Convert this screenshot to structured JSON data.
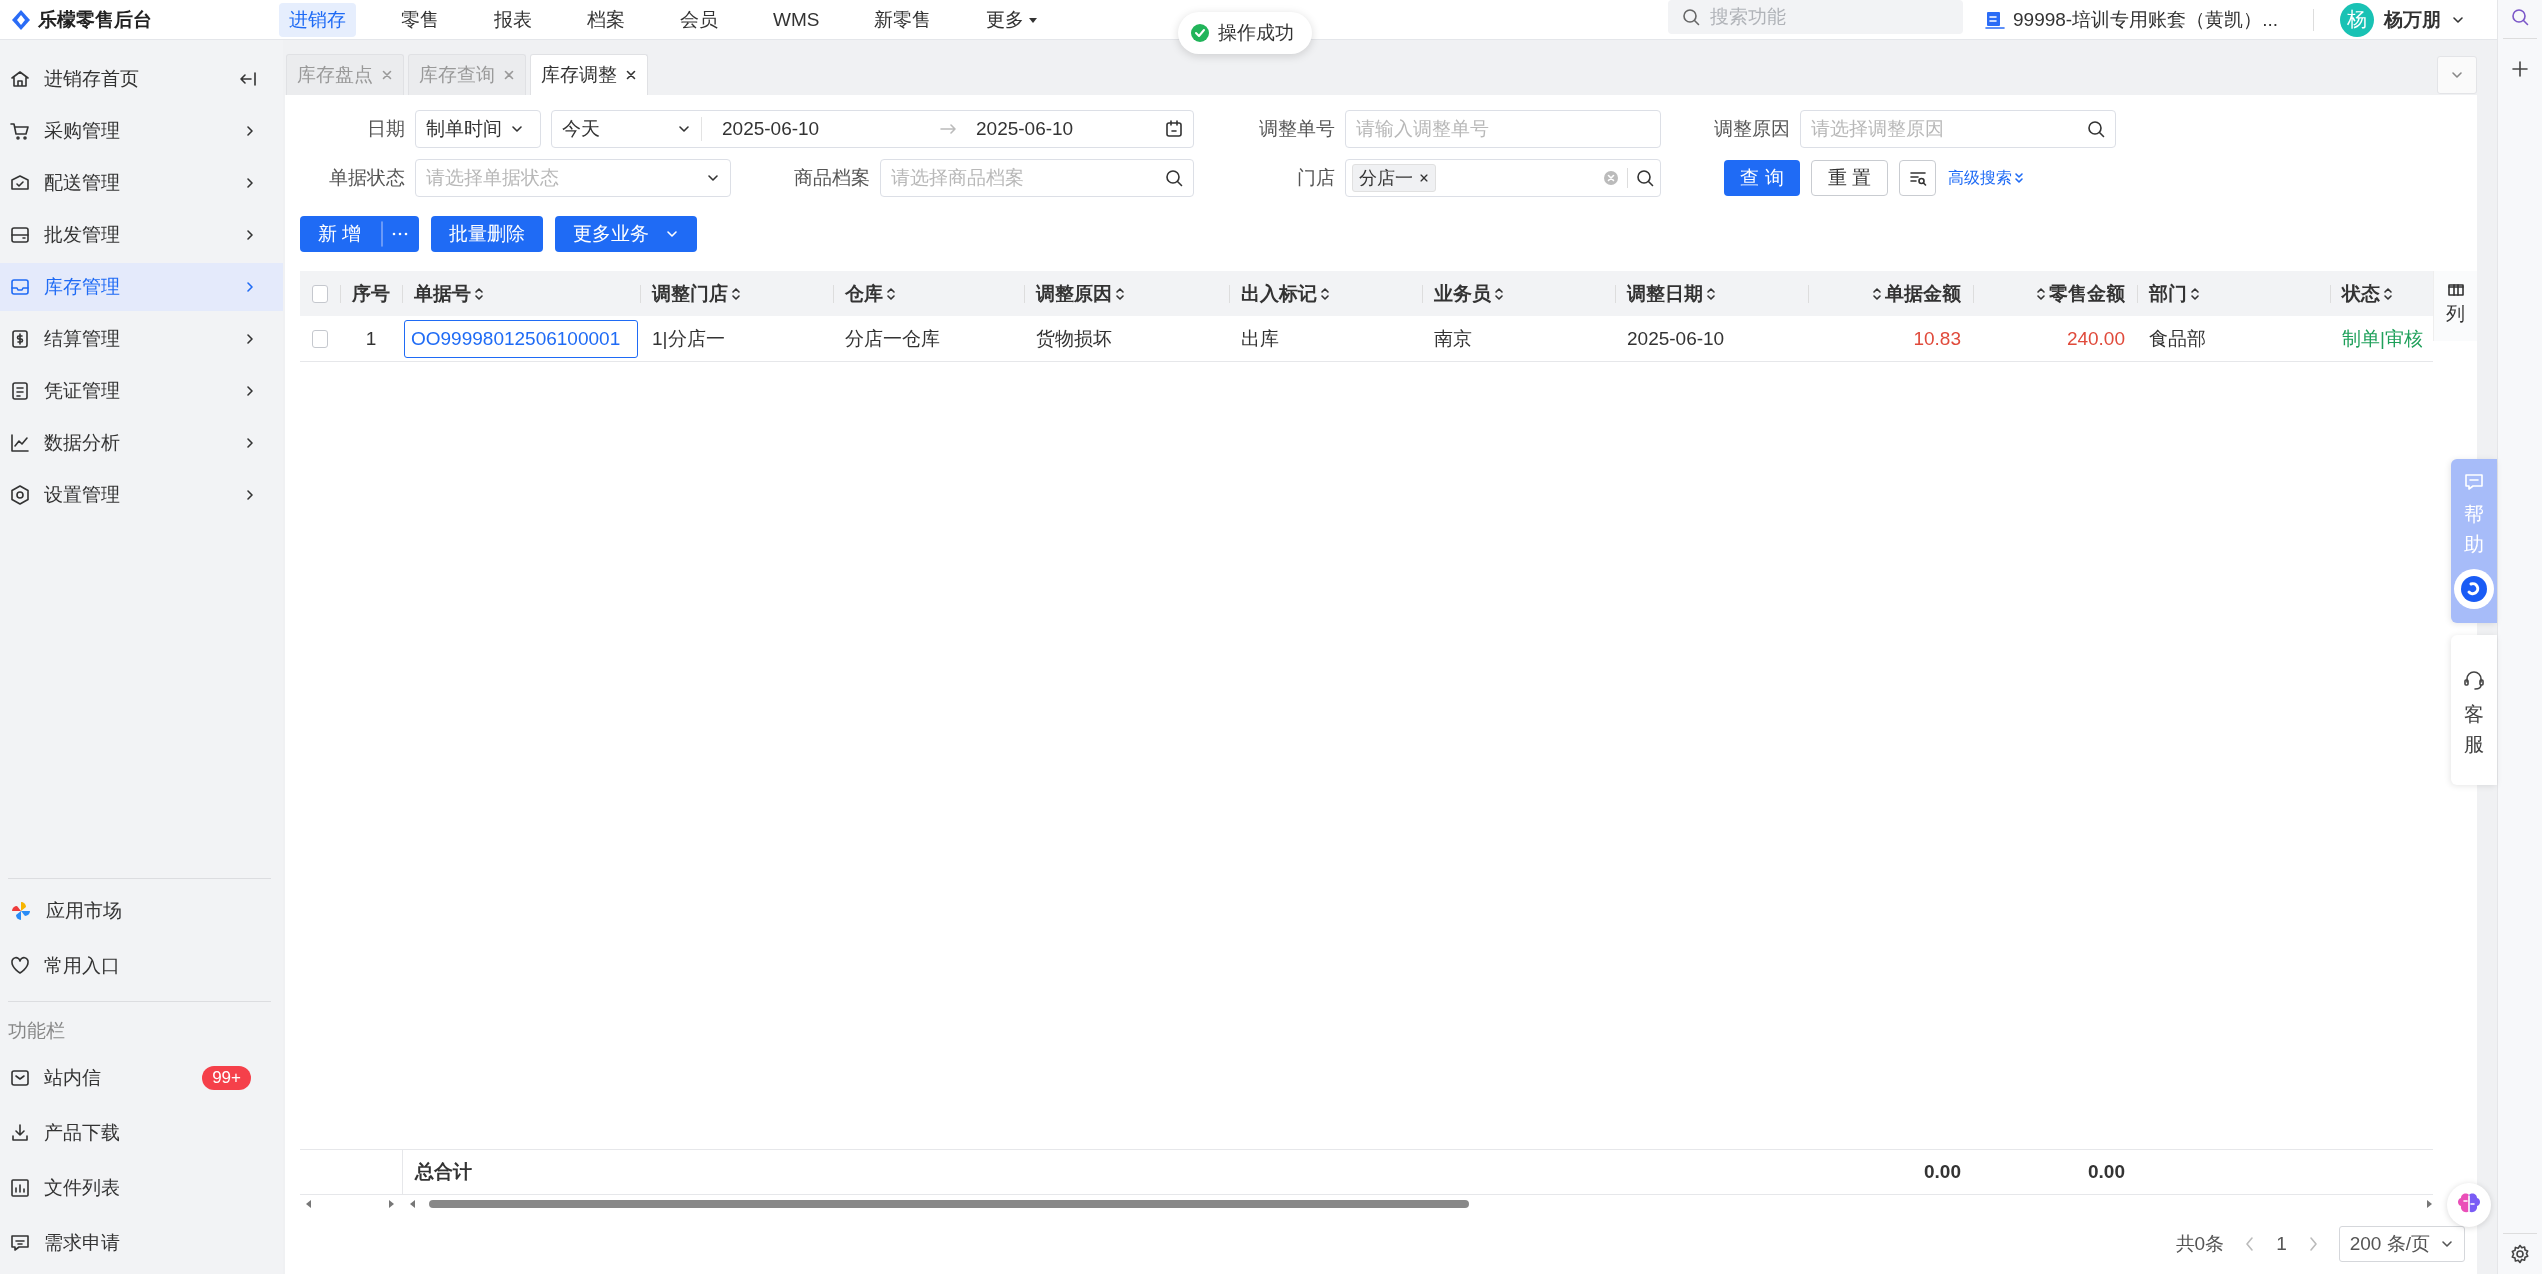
{
  "app": {
    "title": "乐檬零售后台"
  },
  "top_nav": [
    {
      "label": "进销存",
      "selected": true,
      "kind": "link"
    },
    {
      "label": "零售",
      "selected": false,
      "kind": "link"
    },
    {
      "label": "报表",
      "selected": false,
      "kind": "link"
    },
    {
      "label": "档案",
      "selected": false,
      "kind": "link"
    },
    {
      "label": "会员",
      "selected": false,
      "kind": "link"
    },
    {
      "label": "WMS",
      "selected": false,
      "kind": "link"
    },
    {
      "label": "新零售",
      "selected": false,
      "kind": "link"
    },
    {
      "label": "更多",
      "selected": false,
      "kind": "menu"
    }
  ],
  "toast": {
    "text": "操作成功"
  },
  "search": {
    "placeholder": "搜索功能"
  },
  "account": {
    "text": "99998-培训专用账套（黄凯）..."
  },
  "user": {
    "avatar": "杨",
    "name": "杨万朋"
  },
  "sidebar": {
    "items": [
      {
        "label": "进销存首页",
        "selected": false,
        "kind": "home"
      },
      {
        "label": "采购管理",
        "selected": false,
        "kind": "group"
      },
      {
        "label": "配送管理",
        "selected": false,
        "kind": "group"
      },
      {
        "label": "批发管理",
        "selected": false,
        "kind": "group"
      },
      {
        "label": "库存管理",
        "selected": true,
        "kind": "group"
      },
      {
        "label": "结算管理",
        "selected": false,
        "kind": "group"
      },
      {
        "label": "凭证管理",
        "selected": false,
        "kind": "group"
      },
      {
        "label": "数据分析",
        "selected": false,
        "kind": "group"
      },
      {
        "label": "设置管理",
        "selected": false,
        "kind": "group"
      }
    ],
    "shortcuts": [
      {
        "label": "应用市场"
      },
      {
        "label": "常用入口"
      }
    ],
    "tools_title": "功能栏",
    "tools": [
      {
        "label": "站内信",
        "badge": "99+"
      },
      {
        "label": "产品下载"
      },
      {
        "label": "文件列表"
      },
      {
        "label": "需求申请"
      }
    ]
  },
  "tabs": [
    {
      "label": "库存盘点",
      "selected": false
    },
    {
      "label": "库存查询",
      "selected": false
    },
    {
      "label": "库存调整",
      "selected": true
    }
  ],
  "filters": {
    "date": {
      "label": "日期",
      "type_value": "制单时间",
      "preset": "今天",
      "start": "2025-06-10",
      "end": "2025-06-10"
    },
    "adjust_no": {
      "label": "调整单号",
      "placeholder": "请输入调整单号"
    },
    "reason": {
      "label": "调整原因",
      "placeholder": "请选择调整原因"
    },
    "status": {
      "label": "单据状态",
      "placeholder": "请选择单据状态"
    },
    "product": {
      "label": "商品档案",
      "placeholder": "请选择商品档案"
    },
    "store": {
      "label": "门店",
      "tags": [
        "分店一"
      ]
    },
    "query_button": "查 询",
    "reset_button": "重 置",
    "advanced_link": "高级搜索"
  },
  "toolbar": {
    "new_button": "新 增",
    "batch_delete_button": "批量删除",
    "more_button": "更多业务"
  },
  "table": {
    "select_all": {
      "checked": false
    },
    "columns": [
      {
        "label": "序号",
        "kind": "index",
        "sortable": false
      },
      {
        "label": "单据号",
        "kind": "link",
        "sortable": true
      },
      {
        "label": "调整门店",
        "kind": "text",
        "sortable": true
      },
      {
        "label": "仓库",
        "kind": "text",
        "sortable": true
      },
      {
        "label": "调整原因",
        "kind": "text",
        "sortable": true
      },
      {
        "label": "出入标记",
        "kind": "text",
        "sortable": true
      },
      {
        "label": "业务员",
        "kind": "text",
        "sortable": true
      },
      {
        "label": "调整日期",
        "kind": "text",
        "sortable": true
      },
      {
        "label": "单据金额",
        "kind": "amount",
        "sortable": true
      },
      {
        "label": "零售金额",
        "kind": "amount",
        "sortable": true
      },
      {
        "label": "部门",
        "kind": "text",
        "sortable": true
      },
      {
        "label": "状态",
        "kind": "status",
        "sortable": true
      }
    ],
    "rows": [
      {
        "checked": false,
        "cells": [
          {
            "text": "1",
            "focused": false
          },
          {
            "text": "OO99998012506100001",
            "focused": true
          },
          {
            "text": "1|分店一",
            "focused": false
          },
          {
            "text": "分店一仓库",
            "focused": false
          },
          {
            "text": "货物损坏",
            "focused": false
          },
          {
            "text": "出库",
            "focused": false
          },
          {
            "text": "南京",
            "focused": false
          },
          {
            "text": "2025-06-10",
            "focused": false
          },
          {
            "text": "10.83",
            "focused": false
          },
          {
            "text": "240.00",
            "focused": false
          },
          {
            "text": "食品部",
            "focused": false
          },
          {
            "text": "制单|审核",
            "focused": false
          }
        ]
      }
    ],
    "totals": {
      "label": "总合计",
      "amounts": [
        "0.00",
        "0.00"
      ]
    },
    "column_settings": "列"
  },
  "pagination": {
    "total": "共0条",
    "page": "1",
    "page_size": "200 条/页"
  },
  "side_widgets": [
    {
      "label": "帮助",
      "kind": "help"
    },
    {
      "label": "客服",
      "kind": "service"
    }
  ]
}
